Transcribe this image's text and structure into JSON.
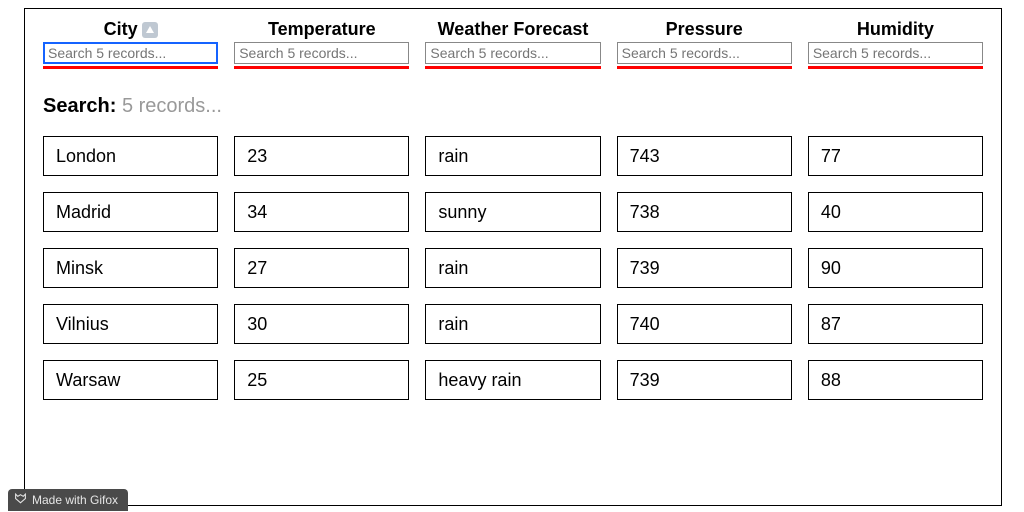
{
  "columns": {
    "city": {
      "label": "City",
      "placeholder": "Search 5 records...",
      "sortable": true,
      "sort_dir": "asc"
    },
    "temperature": {
      "label": "Temperature",
      "placeholder": "Search 5 records..."
    },
    "forecast": {
      "label": "Weather Forecast",
      "placeholder": "Search 5 records..."
    },
    "pressure": {
      "label": "Pressure",
      "placeholder": "Search 5 records..."
    },
    "humidity": {
      "label": "Humidity",
      "placeholder": "Search 5 records..."
    }
  },
  "search": {
    "label": "Search:",
    "value": "5 records..."
  },
  "rows": [
    {
      "city": "London",
      "temperature": "23",
      "forecast": "rain",
      "pressure": "743",
      "humidity": "77"
    },
    {
      "city": "Madrid",
      "temperature": "34",
      "forecast": "sunny",
      "pressure": "738",
      "humidity": "40"
    },
    {
      "city": "Minsk",
      "temperature": "27",
      "forecast": "rain",
      "pressure": "739",
      "humidity": "90"
    },
    {
      "city": "Vilnius",
      "temperature": "30",
      "forecast": "rain",
      "pressure": "740",
      "humidity": "87"
    },
    {
      "city": "Warsaw",
      "temperature": "25",
      "forecast": "heavy rain",
      "pressure": "739",
      "humidity": "88"
    }
  ],
  "footer_badge": "Made with Gifox"
}
